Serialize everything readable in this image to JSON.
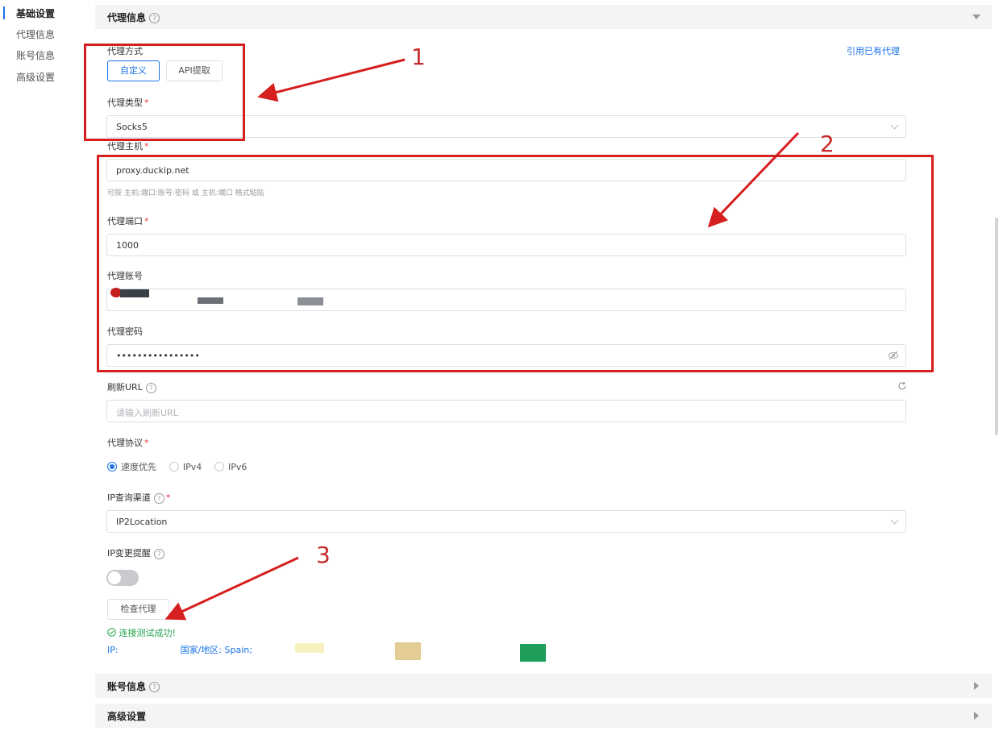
{
  "nav": {
    "items": [
      "基础设置",
      "代理信息",
      "账号信息",
      "高级设置"
    ]
  },
  "sections": {
    "proxy_info": "代理信息",
    "account_info": "账号信息",
    "advanced": "高级设置"
  },
  "form": {
    "proxy_mode_label": "代理方式",
    "mode_custom": "自定义",
    "mode_api": "API提取",
    "use_existing_link": "引用已有代理",
    "proxy_type_label": "代理类型",
    "proxy_type_value": "Socks5",
    "host_label": "代理主机",
    "host_value": "proxy.duckip.net",
    "host_hint": "可按 主机:端口:账号:密码 或 主机:端口 格式粘贴",
    "port_label": "代理端口",
    "port_value": "1000",
    "account_label": "代理账号",
    "password_label": "代理密码",
    "password_value": "••••••••••••••••",
    "refresh_url_label": "刷新URL",
    "refresh_url_placeholder": "请输入刷新URL",
    "protocol_label": "代理协议",
    "protocol_options": [
      "速度优先",
      "IPv4",
      "IPv6"
    ],
    "ip_channel_label": "IP查询渠道",
    "ip_channel_value": "IP2Location",
    "ip_change_label": "IP变更提醒",
    "check_button": "检查代理",
    "success_text": "连接测试成功!",
    "ip_prefix": "IP:",
    "country_text": "国家/地区: Spain;"
  },
  "annotations": [
    "1",
    "2",
    "3"
  ],
  "colors": {
    "accent": "#1a73e8",
    "annotation": "#d61f1f",
    "success": "#22a34a"
  }
}
